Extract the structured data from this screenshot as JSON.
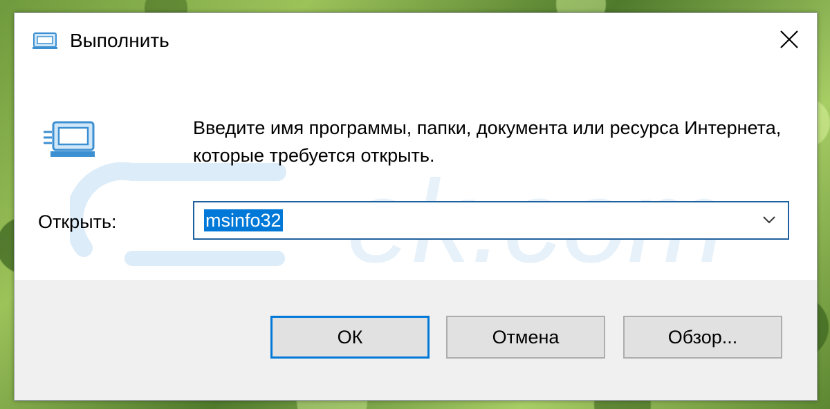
{
  "window": {
    "title": "Выполнить",
    "close_icon": "close-icon",
    "title_icon": "run-icon"
  },
  "content": {
    "icon": "run-icon",
    "prompt": "Введите имя программы, папки, документа или ресурса Интернета, которые требуется открыть.",
    "open_label": "Открыть:",
    "open_value": "msinfo32",
    "dropdown_icon": "chevron-down-icon",
    "watermark": "ek.com"
  },
  "buttons": {
    "ok": "ОК",
    "cancel": "Отмена",
    "browse": "Обзор..."
  },
  "colors": {
    "selection": "#0078d7",
    "focus_border": "#1e5f9e",
    "footer_bg": "#f0f0f0",
    "button_bg": "#e1e1e1"
  }
}
